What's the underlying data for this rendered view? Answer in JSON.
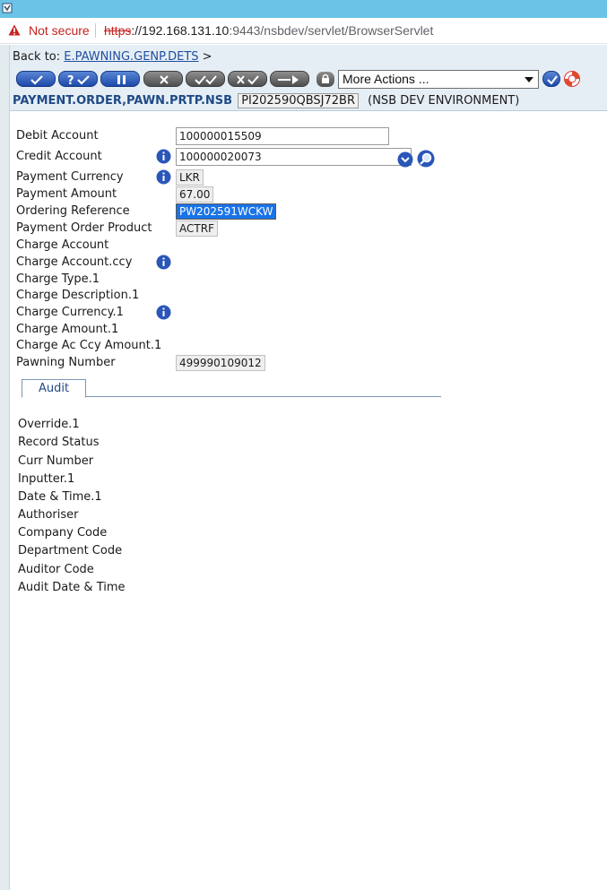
{
  "browser": {
    "security_label": "Not secure",
    "url_scheme": "https",
    "url_host": "://192.168.131.10",
    "url_rest": ":9443/nsbdev/servlet/BrowserServlet"
  },
  "header": {
    "back_to_label": "Back to:",
    "back_to_link": "E.PAWNING.GENP.DETS",
    "back_to_suffix": ">",
    "more_actions": "More Actions ...",
    "app_name": "PAYMENT.ORDER,PAWN.PRTP.NSB",
    "record_id": "PI202590QBSJ72BR",
    "environment": "(NSB DEV ENVIRONMENT)",
    "toolbar": [
      {
        "name": "commit-button",
        "icon": "check-icon",
        "color": "blue"
      },
      {
        "name": "validate-button",
        "icon": "question-check-icon",
        "color": "blue"
      },
      {
        "name": "hold-button",
        "icon": "pause-icon",
        "color": "blue"
      },
      {
        "name": "delete-button",
        "icon": "cross-icon",
        "color": "grey"
      },
      {
        "name": "authorise-button",
        "icon": "double-check-icon",
        "color": "grey"
      },
      {
        "name": "reverse-button",
        "icon": "cross-check-icon",
        "color": "grey"
      },
      {
        "name": "view-button",
        "icon": "play-icon",
        "color": "grey"
      }
    ]
  },
  "form": {
    "debit_account": {
      "label": "Debit Account",
      "value": "100000015509"
    },
    "credit_account": {
      "label": "Credit Account",
      "value": "100000020073"
    },
    "payment_currency": {
      "label": "Payment Currency",
      "value": "LKR"
    },
    "payment_amount": {
      "label": "Payment Amount",
      "value": "67.00"
    },
    "ordering_reference": {
      "label": "Ordering Reference",
      "value": "PW202591WCKW"
    },
    "payment_order_product": {
      "label": "Payment Order Product",
      "value": "ACTRF"
    },
    "charge_account": {
      "label": "Charge Account"
    },
    "charge_account_ccy": {
      "label": "Charge Account.ccy"
    },
    "charge_type": {
      "label": "Charge Type.1"
    },
    "charge_description": {
      "label": "Charge Description.1"
    },
    "charge_currency": {
      "label": "Charge Currency.1"
    },
    "charge_amount": {
      "label": "Charge Amount.1"
    },
    "charge_ac_ccy_amount": {
      "label": "Charge Ac Ccy Amount.1"
    },
    "pawning_number": {
      "label": "Pawning Number",
      "value": "499990109012"
    }
  },
  "tabs": {
    "audit": "Audit"
  },
  "audit": {
    "rows": [
      "Override.1",
      "Record Status",
      "Curr Number",
      "Inputter.1",
      "Date & Time.1",
      "Authoriser",
      "Company Code",
      "Department Code",
      "Auditor Code",
      "Audit Date & Time"
    ]
  },
  "colors": {
    "accent_blue": "#1d4aa8",
    "title_strip": "#6cc3e8",
    "selection": "#1a73e8",
    "warning_red": "#c5221f"
  }
}
